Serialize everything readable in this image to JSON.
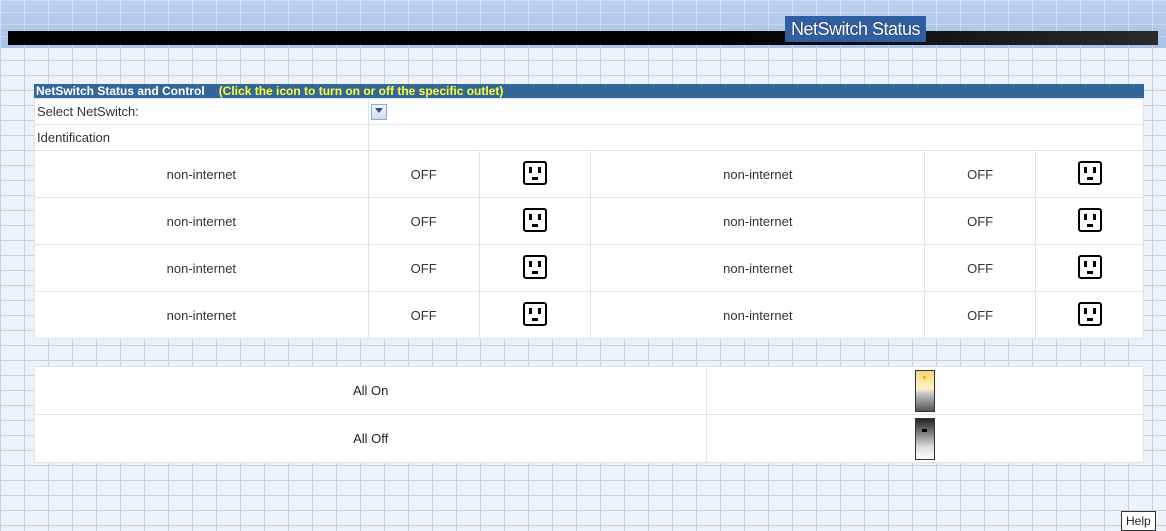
{
  "header": {
    "title": "NetSwitch Status"
  },
  "panel": {
    "title": "NetSwitch Status and Control",
    "hint": "(Click the icon to turn on or off the specific outlet)",
    "select_label": "Select NetSwitch:",
    "select_value": "",
    "identification_label": "Identification",
    "identification_value": ""
  },
  "outlets": [
    {
      "left": {
        "name": "non-internet",
        "state": "OFF"
      },
      "right": {
        "name": "non-internet",
        "state": "OFF"
      }
    },
    {
      "left": {
        "name": "non-internet",
        "state": "OFF"
      },
      "right": {
        "name": "non-internet",
        "state": "OFF"
      }
    },
    {
      "left": {
        "name": "non-internet",
        "state": "OFF"
      },
      "right": {
        "name": "non-internet",
        "state": "OFF"
      }
    },
    {
      "left": {
        "name": "non-internet",
        "state": "OFF"
      },
      "right": {
        "name": "non-internet",
        "state": "OFF"
      }
    }
  ],
  "all_controls": {
    "all_on_label": "All On",
    "all_off_label": "All Off"
  },
  "help_label": "Help",
  "icons": {
    "outlet": "power-outlet-icon",
    "all_on": "switch-on-icon",
    "all_off": "switch-off-icon",
    "dropdown": "chevron-down-icon"
  },
  "colors": {
    "panel_header_bg": "#336699",
    "panel_hint": "#ffff33",
    "header_title_bg": "#2f5f9f"
  }
}
